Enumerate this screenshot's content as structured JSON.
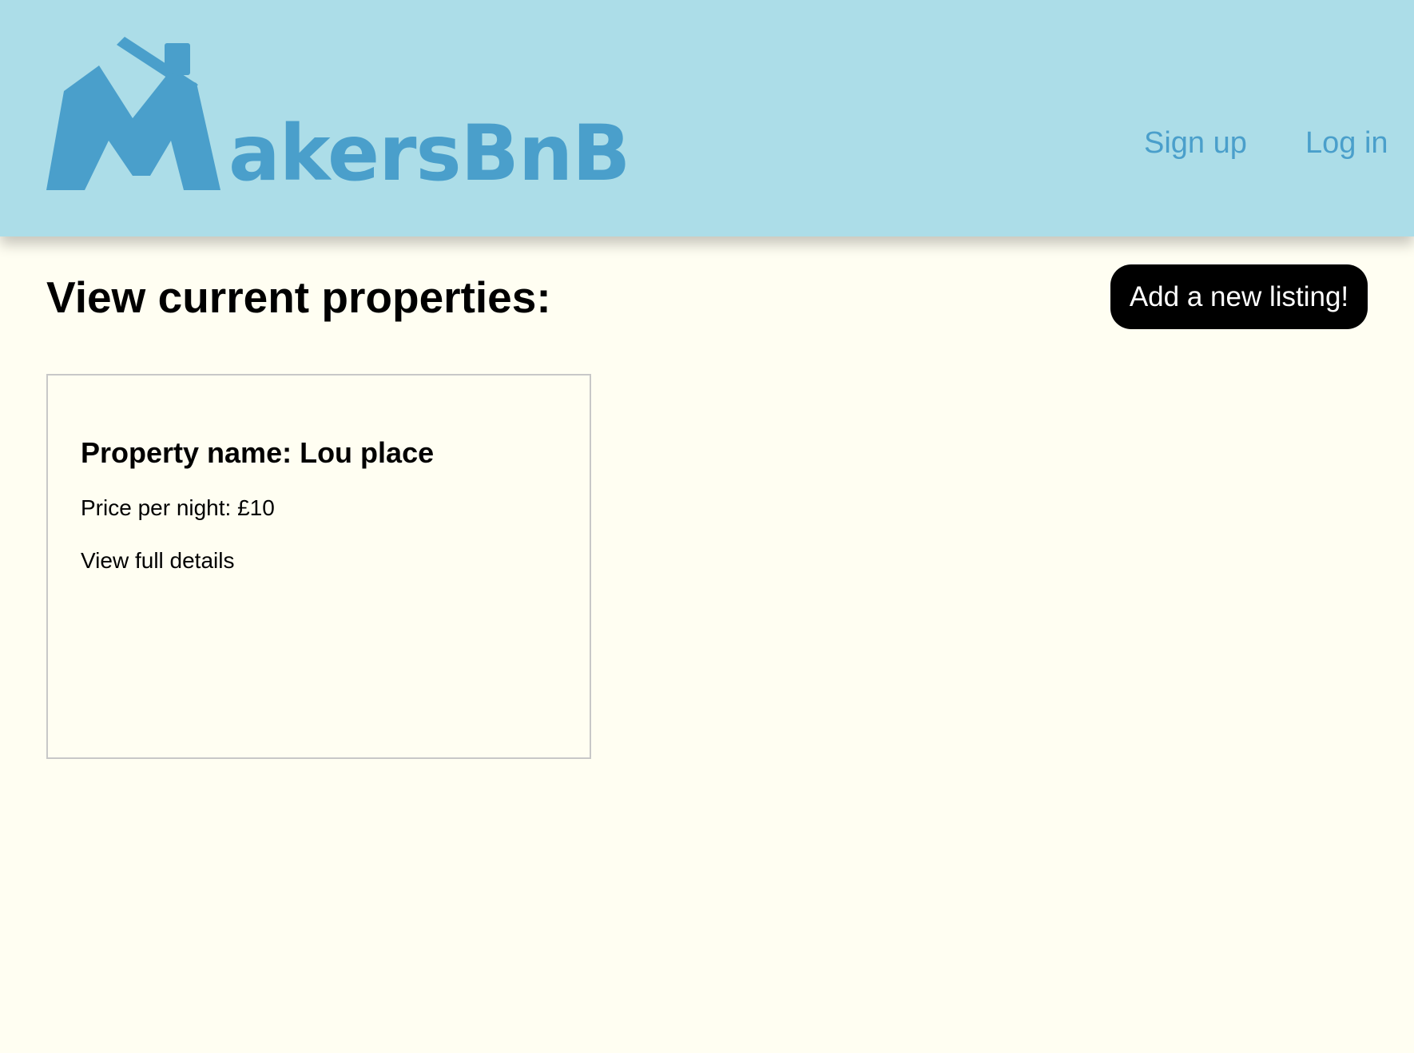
{
  "colors": {
    "header_background": "#acdde8",
    "brand_blue": "#4a9fcb",
    "page_background": "#fffef2",
    "button_background": "#000000",
    "button_text": "#ffffff"
  },
  "header": {
    "logo_icon": "house-m-icon",
    "logo_text": "akersBnB",
    "nav": {
      "signup_label": "Sign up",
      "login_label": "Log in"
    }
  },
  "main": {
    "title": "View current properties:",
    "add_listing_label": "Add a new listing!",
    "listings": [
      {
        "name": "Property name: Lou place",
        "price": "Price per night: £10",
        "details_link": "View full details"
      }
    ]
  }
}
